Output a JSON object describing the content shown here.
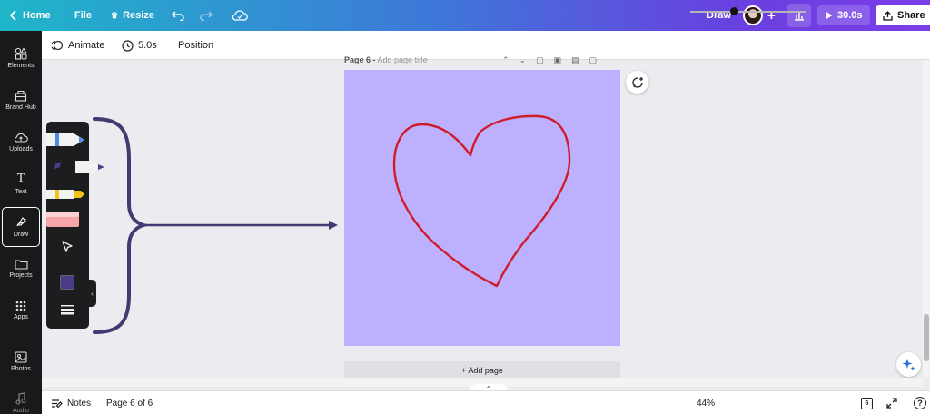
{
  "topbar": {
    "home_label": "Home",
    "file_label": "File",
    "resize_label": "Resize",
    "mode_label": "Draw",
    "duration_label": "30.0s",
    "share_label": "Share"
  },
  "subbar": {
    "animate_label": "Animate",
    "duration_label": "5.0s",
    "position_label": "Position"
  },
  "sidebar": {
    "items": [
      {
        "label": "Elements"
      },
      {
        "label": "Brand Hub"
      },
      {
        "label": "Uploads"
      },
      {
        "label": "Text"
      },
      {
        "label": "Draw",
        "active": true
      },
      {
        "label": "Projects"
      },
      {
        "label": "Apps"
      },
      {
        "label": "Photos"
      },
      {
        "label": "Audio"
      }
    ]
  },
  "canvas": {
    "page_label": "Page 6 -",
    "page_title_placeholder": "Add page title",
    "add_page_label": "+ Add page",
    "page_color": "#bdb0fe",
    "stroke_color": "#d01c2a"
  },
  "draw_palette": {
    "tools": [
      "pen",
      "marker",
      "highlighter",
      "eraser",
      "select"
    ],
    "current_color": "#4b3b8a",
    "annotation_color": "#463870"
  },
  "bottombar": {
    "notes_label": "Notes",
    "page_indicator": "Page 6 of 6",
    "zoom_label": "44%",
    "zoom_level": 0.44,
    "page_count": "6",
    "help_label": "?"
  }
}
